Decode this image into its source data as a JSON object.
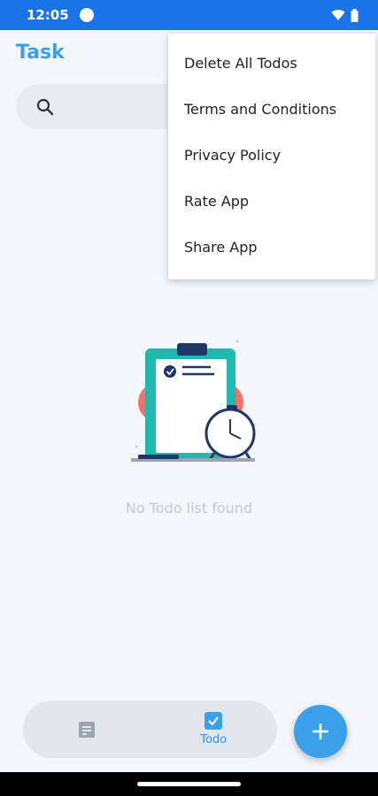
{
  "status_bar": {
    "time": "12:05"
  },
  "app": {
    "title": "Task"
  },
  "menu": {
    "items": [
      {
        "label": "Delete All Todos"
      },
      {
        "label": "Terms and Conditions"
      },
      {
        "label": "Privacy Policy"
      },
      {
        "label": "Rate App"
      },
      {
        "label": "Share App"
      }
    ]
  },
  "empty_state": {
    "message": "No Todo list found"
  },
  "bottom_nav": {
    "items": [
      {
        "label": "",
        "icon": "notes-icon",
        "active": false
      },
      {
        "label": "Todo",
        "icon": "checkbox-icon",
        "active": true
      }
    ]
  },
  "colors": {
    "accent": "#3aa0ec",
    "status_bar": "#1a73e8",
    "illustration_teal": "#1fb9b0",
    "illustration_red": "#f07268",
    "navy": "#1f3566"
  }
}
